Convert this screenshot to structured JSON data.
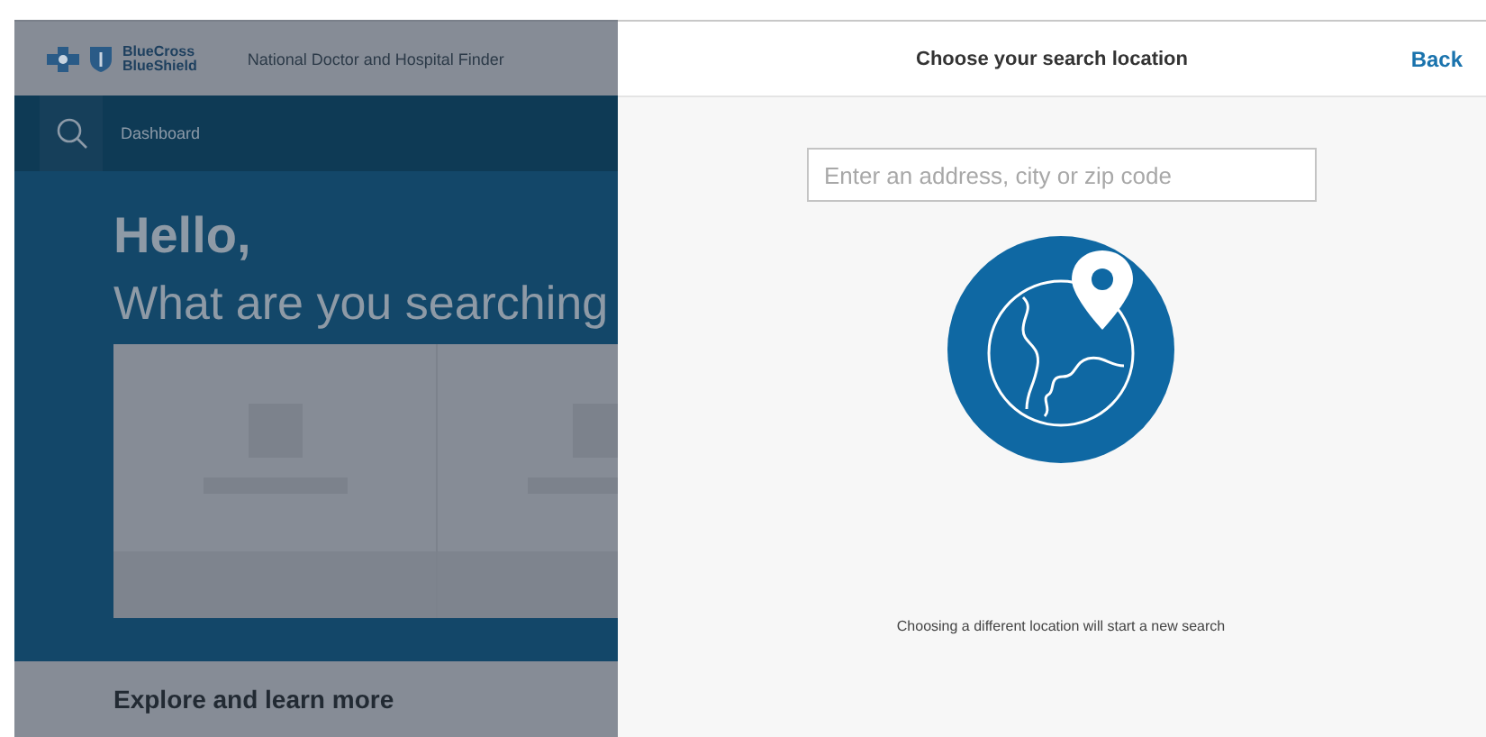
{
  "background_page": {
    "brand_lines": [
      "BlueCross",
      "BlueShield"
    ],
    "header_title": "National Doctor and Hospital Finder",
    "nav": {
      "label": "Dashboard"
    },
    "hero": {
      "greeting": "Hello,",
      "question": "What are you searching"
    },
    "cards": [
      {
        "kind": "placeholder"
      },
      {
        "kind": "placeholder"
      }
    ],
    "section_title": "Explore and learn more"
  },
  "location_panel": {
    "title": "Choose your search location",
    "back": "Back",
    "search": {
      "placeholder": "Enter an address, city or zip code"
    },
    "message": "Choosing a different location will start a new search"
  }
}
